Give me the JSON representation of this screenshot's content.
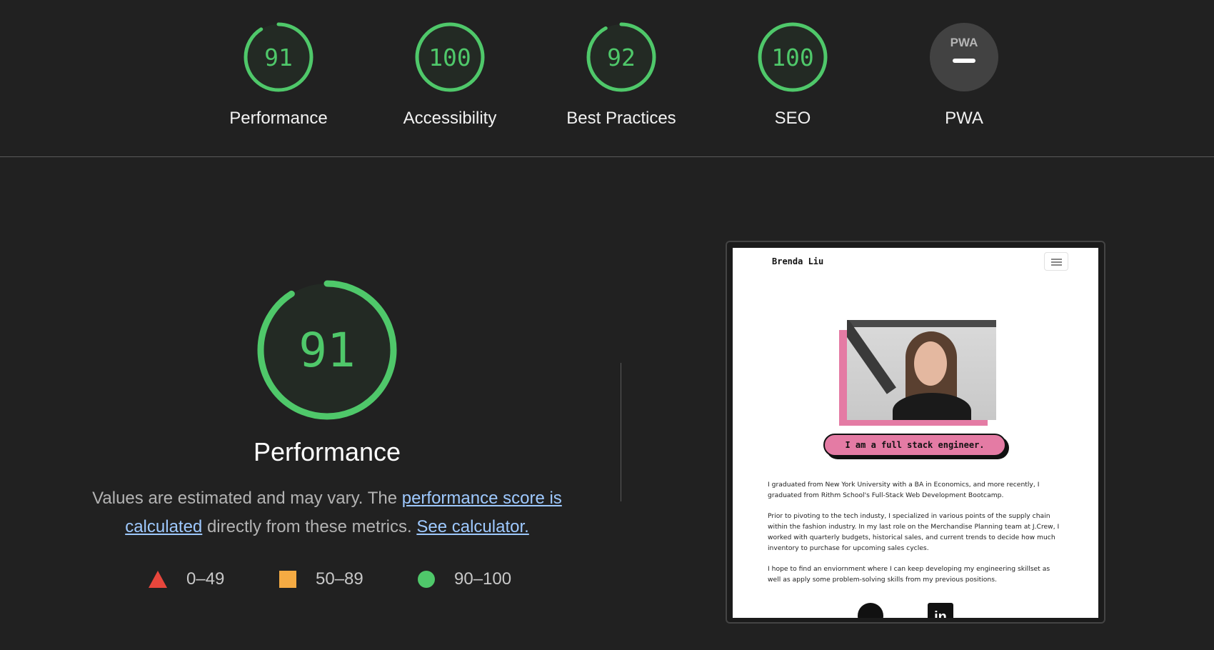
{
  "categories": [
    {
      "label": "Performance",
      "score": "91",
      "fraction": 0.91
    },
    {
      "label": "Accessibility",
      "score": "100",
      "fraction": 1.0
    },
    {
      "label": "Best Practices",
      "score": "92",
      "fraction": 0.92
    },
    {
      "label": "SEO",
      "score": "100",
      "fraction": 1.0
    },
    {
      "label": "PWA",
      "score": "—",
      "badge": "PWA"
    }
  ],
  "main": {
    "score": "91",
    "fraction": 0.91,
    "title": "Performance",
    "desc_prefix": "Values are estimated and may vary. The ",
    "desc_link": "performance score is calculated",
    "desc_mid": " directly from these metrics. ",
    "desc_link2": "See calculator."
  },
  "legend": [
    {
      "range": "0–49",
      "shape": "triangle",
      "color": "#e8463c"
    },
    {
      "range": "50–89",
      "shape": "square",
      "color": "#f5ab43"
    },
    {
      "range": "90–100",
      "shape": "circle",
      "color": "#4fc86a"
    }
  ],
  "colors": {
    "pass": "#4fc86a",
    "background": "#212121",
    "link": "#9ec9ff"
  },
  "screenshot": {
    "brand": "Brenda Liu",
    "tagline": "I am a full stack engineer.",
    "paragraphs": [
      "I graduated from New York University with a BA in Economics, and more recently, I graduated from Rithm School's Full-Stack Web Development Bootcamp.",
      "Prior to pivoting to the tech industy, I specialized in various points of the supply chain within the fashion industry. In my last role on the Merchandise Planning team at J.Crew, I worked with quarterly budgets, historical sales, and current trends to decide how much inventory to purchase for upcoming sales cycles.",
      "I hope to find an enviornment where I can keep developing my engineering skillset as well as apply some problem-solving skills from my previous positions."
    ],
    "linkedin_glyph": "in"
  }
}
